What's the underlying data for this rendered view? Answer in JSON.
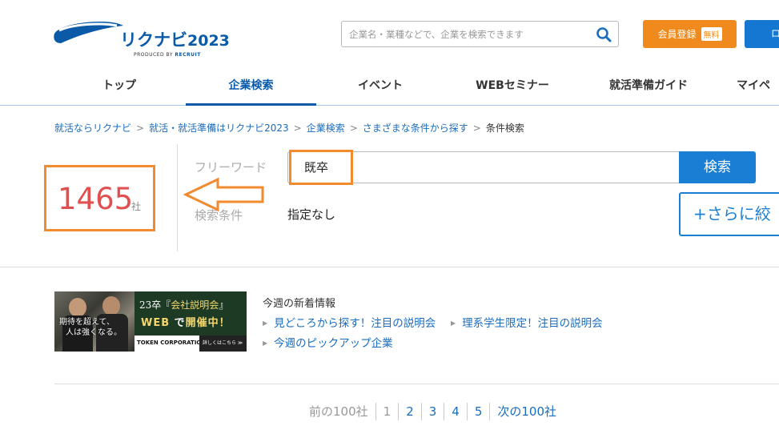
{
  "header": {
    "logo_text": "リクナビ",
    "logo_year": "2023",
    "logo_produced_by": "PRODUCED BY",
    "logo_recruit": "RECRUIT",
    "search_placeholder": "企業名・業種などで、企業を検索できます",
    "register_label": "会員登録",
    "register_tag": "無料",
    "login_label": "ロ"
  },
  "nav": {
    "items": [
      {
        "label": "トップ"
      },
      {
        "label": "企業検索",
        "active": true
      },
      {
        "label": "イベント"
      },
      {
        "label": "WEBセミナー"
      },
      {
        "label": "就活準備ガイド"
      },
      {
        "label": "マイペ"
      }
    ]
  },
  "breadcrumb": [
    "就活ならリクナビ",
    "就活・就活準備はリクナビ2023",
    "企業検索",
    "さまざまな条件から探す",
    "条件検索"
  ],
  "result": {
    "count": "1465",
    "unit": "社"
  },
  "search": {
    "freeword_label": "フリーワード",
    "freeword_value": "既卒",
    "search_button": "検索",
    "condition_label": "検索条件",
    "condition_value": "指定なし",
    "refine_button": "+さらに絞"
  },
  "banner": {
    "catch_line1": "期待を超えて、",
    "catch_line2": "人は強くなる。",
    "headline_prefix": "23卒『",
    "headline_highlight": "会社説明会",
    "headline_suffix": "』",
    "sub_prefix": "WEB",
    "sub_middle": " で",
    "sub_highlight": "開催中！",
    "brand": "TOKEN CORPORATION",
    "more": "詳しくはこちら ≫"
  },
  "news": {
    "title": "今週の新着情報",
    "items": [
      "見どころから探す！注目の説明会",
      "理系学生限定！注目の説明会",
      "今週のピックアップ企業"
    ]
  },
  "pager": {
    "prev": "前の100社",
    "pages": [
      "1",
      "2",
      "3",
      "4",
      "5"
    ],
    "next": "次の100社"
  },
  "colors": {
    "brand_blue": "#0a5aa8",
    "link_blue": "#1a6dbf",
    "orange": "#f08a1c",
    "count_red": "#e05050",
    "highlight_orange": "#f28a2e"
  }
}
